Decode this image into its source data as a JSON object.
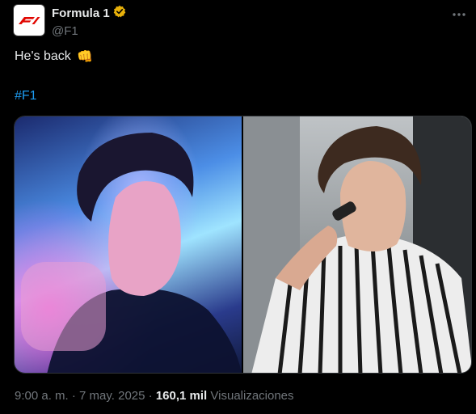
{
  "account": {
    "name": "Formula 1",
    "handle": "@F1",
    "verified_color": "#e8b10a"
  },
  "post": {
    "text": "He's back",
    "emoji": "👊",
    "hashtag": "#F1"
  },
  "media": {
    "count": 2
  },
  "meta": {
    "time": "9:00 a. m.",
    "separator": "·",
    "date": "7 may. 2025",
    "separator2": "·",
    "views_count": "160,1 mil",
    "views_label": "Visualizaciones"
  },
  "colors": {
    "background": "#000000",
    "text": "#e7e9ea",
    "secondary": "#71767b",
    "link": "#1d9bf0",
    "brand": "#e10600"
  }
}
